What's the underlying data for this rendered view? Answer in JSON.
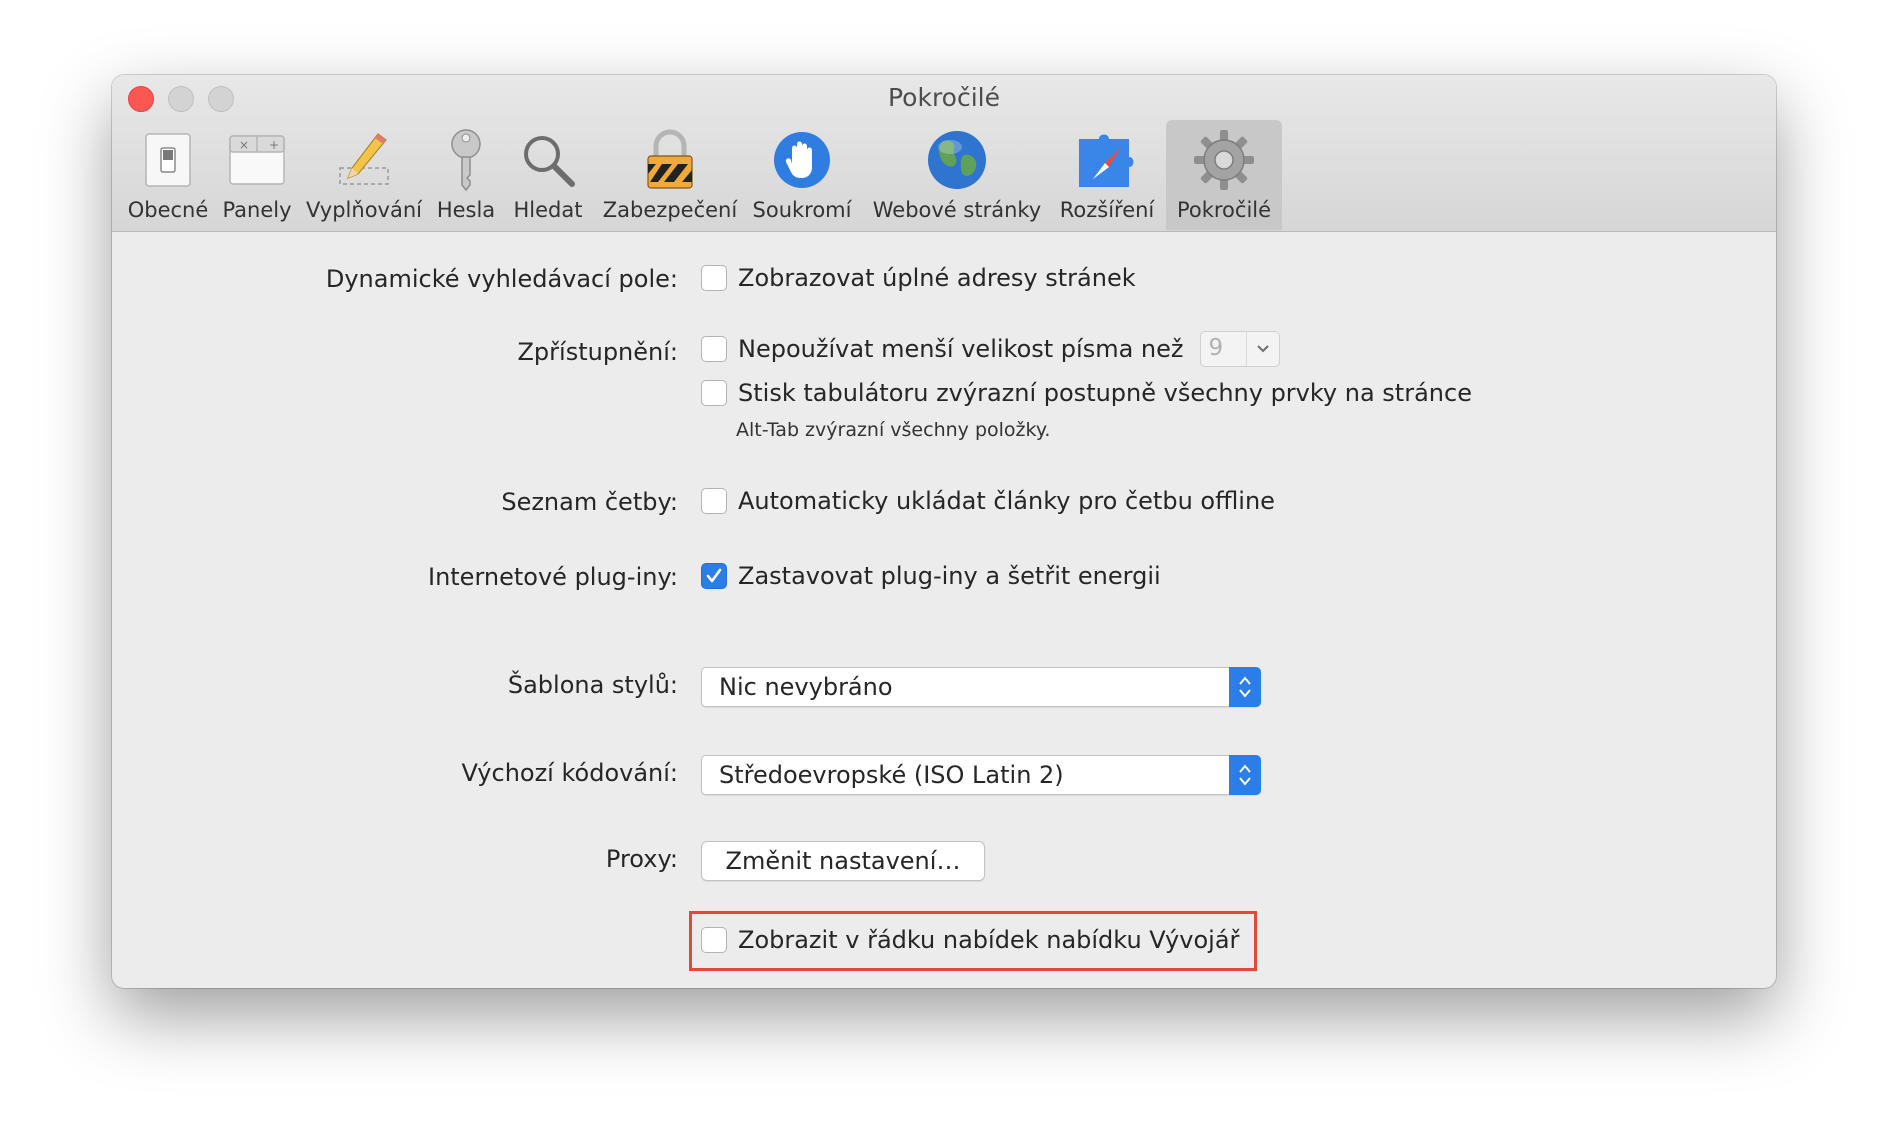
{
  "window": {
    "title": "Pokročilé"
  },
  "toolbar": {
    "tabs": [
      {
        "label": "Obecné",
        "icon": "general-switch-icon"
      },
      {
        "label": "Panely",
        "icon": "tabs-icon"
      },
      {
        "label": "Vyplňování",
        "icon": "autofill-pencil-icon"
      },
      {
        "label": "Hesla",
        "icon": "key-icon"
      },
      {
        "label": "Hledat",
        "icon": "magnifier-icon"
      },
      {
        "label": "Zabezpečení",
        "icon": "padlock-icon"
      },
      {
        "label": "Soukromí",
        "icon": "hand-icon"
      },
      {
        "label": "Webové stránky",
        "icon": "globe-icon"
      },
      {
        "label": "Rozšíření",
        "icon": "puzzle-compass-icon"
      },
      {
        "label": "Pokročilé",
        "icon": "gear-icon",
        "selected": true
      }
    ]
  },
  "settings": {
    "smart_search": {
      "label": "Dynamické vyhledávací pole:",
      "checkbox": {
        "text": "Zobrazovat úplné adresy stránek",
        "checked": false
      }
    },
    "accessibility": {
      "label": "Zpřístupnění:",
      "min_font": {
        "text": "Nepoužívat menší velikost písma než",
        "checked": false,
        "value": "9"
      },
      "tab_highlight": {
        "text": "Stisk tabulátoru zvýrazní postupně všechny prvky na stránce",
        "checked": false
      },
      "hint": "Alt-Tab zvýrazní všechny položky."
    },
    "reading_list": {
      "label": "Seznam četby:",
      "checkbox": {
        "text": "Automaticky ukládat články pro četbu offline",
        "checked": false
      }
    },
    "plugins": {
      "label": "Internetové plug-iny:",
      "checkbox": {
        "text": "Zastavovat plug-iny a šetřit energii",
        "checked": true
      }
    },
    "style_sheet": {
      "label": "Šablona stylů:",
      "value": "Nic nevybráno"
    },
    "encoding": {
      "label": "Výchozí kódování:",
      "value": "Středoevropské (ISO Latin 2)"
    },
    "proxy": {
      "label": "Proxy:",
      "button": "Změnit nastavení…"
    },
    "develop_menu": {
      "text": "Zobrazit v řádku nabídek nabídku Vývojář",
      "checked": false,
      "highlight_color": "#e14a34"
    }
  },
  "help_button": "?",
  "colors": {
    "accent": "#2b7ee8",
    "close": "#fc5753"
  }
}
